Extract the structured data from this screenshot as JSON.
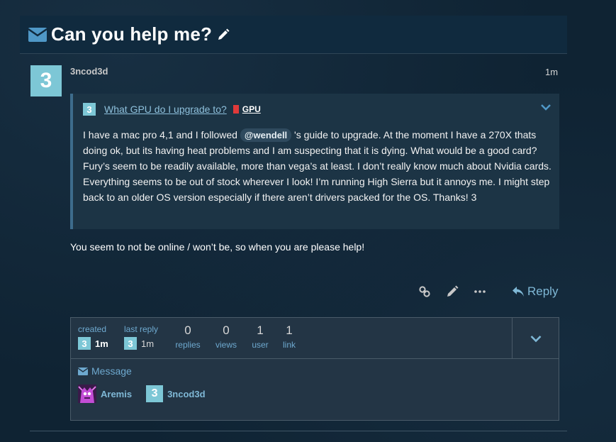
{
  "topic": {
    "title": "Can you help me?"
  },
  "post": {
    "avatar_letter": "3",
    "username": "3ncod3d",
    "age": "1m",
    "quote": {
      "avatar_letter": "3",
      "title": "What GPU do I upgrade to?",
      "category": "GPU",
      "body_before": "I have a mac pro 4,1 and I followed ",
      "mention": "@wendell",
      "body_after": " 's guide to upgrade. At the moment I have a 270X thats doing ok, but its having heat problems and I am suspecting that it is dying. What would be a good card? Fury’s seem to be readily available, more than vega’s at least. I don’t really know much about Nvidia cards. Everything seems to be out of stock wherever I look! I’m running High Sierra but it annoys me. I might step back to an older OS version especially if there aren’t drivers packed for the OS. Thanks! 3"
    },
    "text": "You seem to not be online / won’t be, so when you are please help!",
    "reply_label": "Reply"
  },
  "summary": {
    "created_label": "created",
    "created_avatar": "3",
    "created_time": "1m",
    "last_reply_label": "last reply",
    "last_reply_avatar": "3",
    "last_reply_time": "1m",
    "stats": [
      {
        "num": "0",
        "label": "replies"
      },
      {
        "num": "0",
        "label": "views"
      },
      {
        "num": "1",
        "label": "user"
      },
      {
        "num": "1",
        "label": "link"
      }
    ],
    "message_label": "Message",
    "participants": [
      {
        "name": "Aremis",
        "avatar": "image"
      },
      {
        "name": "3ncod3d",
        "avatar": "3"
      }
    ]
  },
  "colors": {
    "accent": "#7fb8d6",
    "avatar": "#7dc7d6",
    "category": "#e03a3a"
  }
}
